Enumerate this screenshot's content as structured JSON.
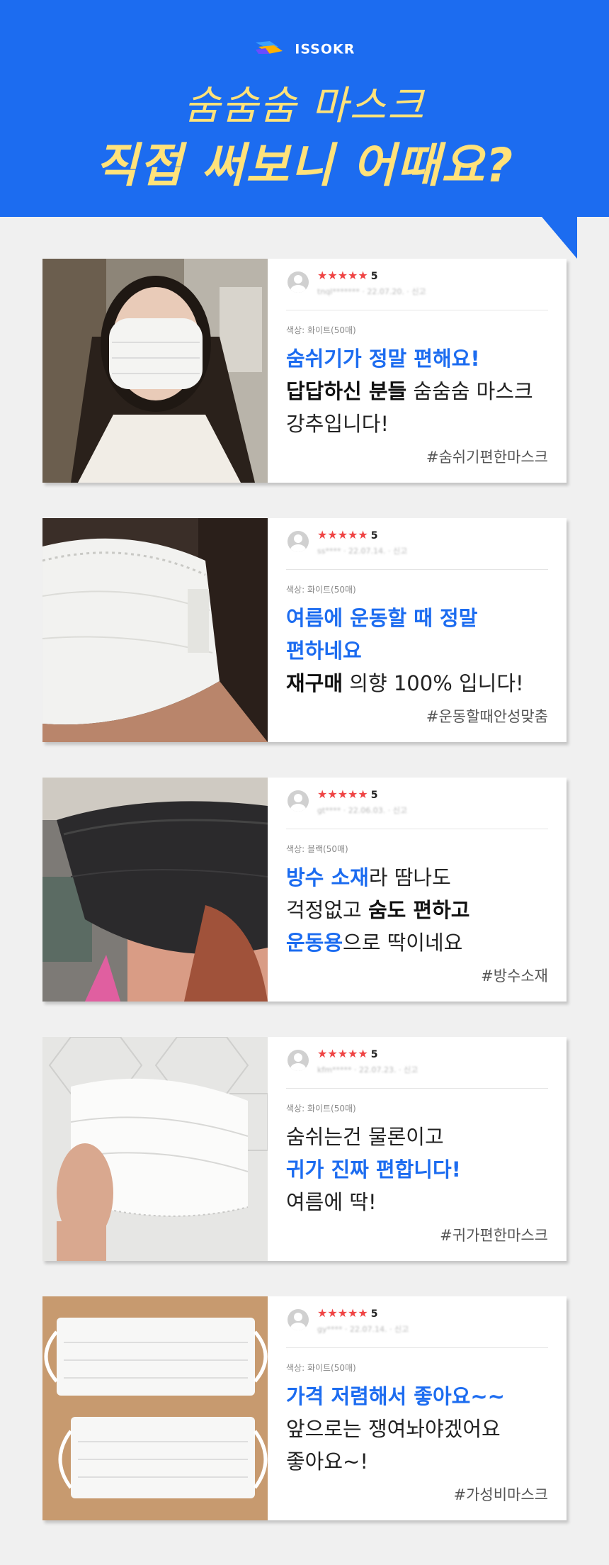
{
  "brand": {
    "name": "ISSOKR"
  },
  "header": {
    "title_line1": "숨숨숨 마스크",
    "title_line2": "직접 써보니 어때요?",
    "bg_color": "#1c6cf0",
    "title_color": "#ffe27a"
  },
  "reviews": [
    {
      "stars": "★★★★★",
      "score": "5",
      "user": "tnql*******",
      "date": "22.07.20.",
      "report": "신고",
      "option": "색상: 화이트(50매)",
      "line1": "숨쉬기가 정말 편해요!",
      "line2_bold": "답답하신 분들",
      "line2_rest": " 숨숨숨 마스크",
      "line3": "강추입니다!",
      "hashtag": "#숨쉬기편한마스크"
    },
    {
      "stars": "★★★★★",
      "score": "5",
      "user": "ss****",
      "date": "22.07.14.",
      "report": "신고",
      "option": "색상: 화이트(50매)",
      "line1": "여름에 운동할 때 정말",
      "line2": "편하네요",
      "line3_bold": "재구매",
      "line3_rest": " 의향 100% 입니다!",
      "hashtag": "#운동할때안성맞춤"
    },
    {
      "stars": "★★★★★",
      "score": "5",
      "user": "gt****",
      "date": "22.06.03.",
      "report": "신고",
      "option": "색상: 블랙(50매)",
      "line1_blue": "방수 소재",
      "line1_rest": "라 땀나도",
      "line2_plain": "걱정없고 ",
      "line2_bold": "숨도 편하고",
      "line3_blue": "운동용",
      "line3_rest": "으로 딱이네요",
      "hashtag": "#방수소재"
    },
    {
      "stars": "★★★★★",
      "score": "5",
      "user": "kfm*****",
      "date": "22.07.23.",
      "report": "신고",
      "option": "색상: 화이트(50매)",
      "line1": "숨쉬는건 물론이고",
      "line2": "귀가 진짜 편합니다!",
      "line3": "여름에 딱!",
      "hashtag": "#귀가편한마스크"
    },
    {
      "stars": "★★★★★",
      "score": "5",
      "user": "gy****",
      "date": "22.07.14.",
      "report": "신고",
      "option": "색상: 화이트(50매)",
      "line1": "가격 저렴해서 좋아요~~",
      "line2": "앞으로는 쟁여놔야겠어요",
      "line3": "좋아요~!",
      "hashtag": "#가성비마스크"
    }
  ]
}
